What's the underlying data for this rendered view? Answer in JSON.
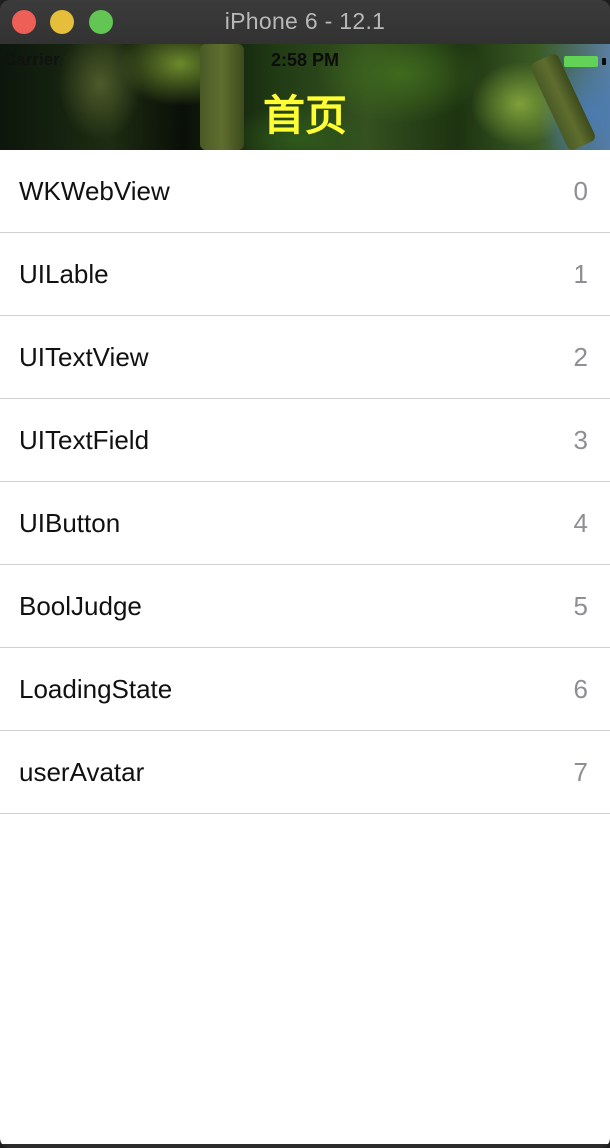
{
  "window": {
    "title": "iPhone 6 - 12.1"
  },
  "status_bar": {
    "carrier": "Carrier",
    "time": "2:58 PM"
  },
  "nav": {
    "title": "首页",
    "title_color": "#ffff33"
  },
  "rows": [
    {
      "title": "WKWebView",
      "detail": "0"
    },
    {
      "title": "UILable",
      "detail": "1"
    },
    {
      "title": "UITextView",
      "detail": "2"
    },
    {
      "title": "UITextField",
      "detail": "3"
    },
    {
      "title": "UIButton",
      "detail": "4"
    },
    {
      "title": "BoolJudge",
      "detail": "5"
    },
    {
      "title": "LoadingState",
      "detail": "6"
    },
    {
      "title": "userAvatar",
      "detail": "7"
    }
  ]
}
